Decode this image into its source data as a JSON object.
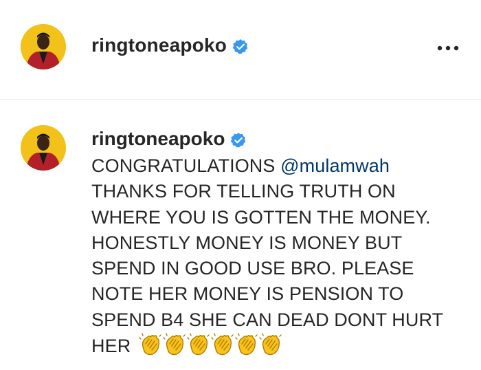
{
  "post_header": {
    "username": "ringtoneapoko",
    "verified_icon": "verified-badge-icon",
    "more_icon": "more-options-icon"
  },
  "comment": {
    "username": "ringtoneapoko",
    "text_before_mention": "CONGRATULATIONS ",
    "mention": "@mulamwah",
    "text_after_mention": "THANKS FOR TELLING TRUTH ON WHERE YOU IS GOTTEN THE MONEY. HONESTLY MONEY IS MONEY BUT SPEND IN GOOD USE BRO. PLEASE NOTE HER MONEY IS PENSION TO SPEND B4 SHE CAN DEAD DONT HURT HER ",
    "emoji": "clapping-hands-icon",
    "emoji_count": 6
  },
  "colors": {
    "verified_blue": "#3897f0",
    "mention_blue": "#00376b",
    "text": "#262626",
    "avatar_bg": "#f2c21b",
    "jacket_red": "#b3202a"
  }
}
